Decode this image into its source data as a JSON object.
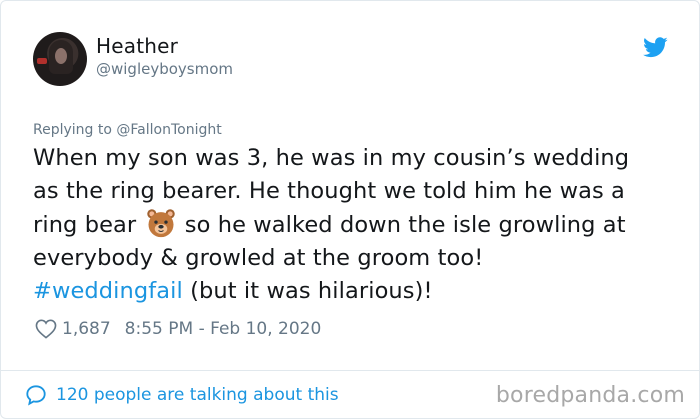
{
  "author": {
    "name": "Heather",
    "handle": "@wigleyboysmom"
  },
  "reply": {
    "prefix": "Replying to ",
    "mention": "@FallonTonight"
  },
  "tweet": {
    "line1": "When my son was 3, he was in my cousin’s wedding",
    "line2": "as the ring bearer. He thought we told him he was a",
    "line3_before": "ring bear",
    "line3_after": "so he walked down the isle growling at",
    "line4": "everybody & growled at the groom too!",
    "hashtag": "#weddingfail",
    "line5_after": " (but it was hilarious)!"
  },
  "meta": {
    "likes": "1,687",
    "timestamp": "8:55 PM - Feb 10, 2020"
  },
  "footer": {
    "talking": "120 people are talking about this",
    "watermark": "boredpanda.com"
  },
  "icons": {
    "bird": "twitter-bird-icon",
    "heart": "heart-icon",
    "bubble": "speech-bubble-icon",
    "bear": "bear-face-emoji"
  },
  "colors": {
    "link": "#1b95e0",
    "muted": "#657786",
    "text": "#14171a",
    "twitter_blue": "#1da1f2"
  }
}
